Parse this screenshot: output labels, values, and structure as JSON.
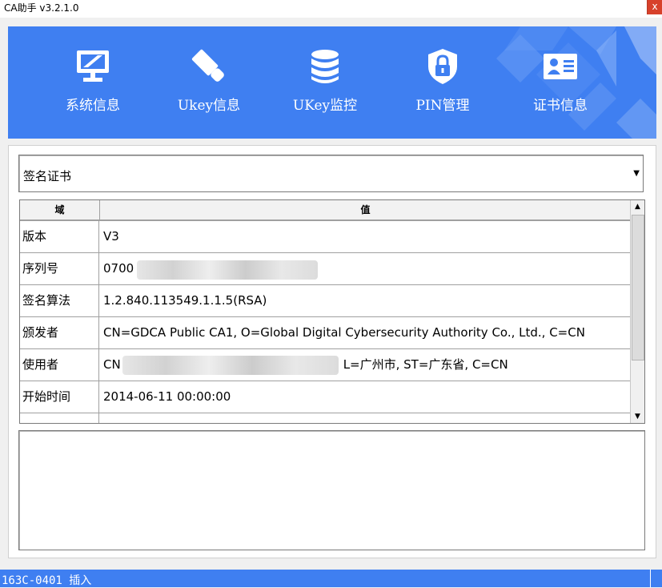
{
  "window": {
    "title": "CA助手 v3.2.1.0",
    "close_label": "x"
  },
  "colors": {
    "brand": "#3f7ff1",
    "close": "#d7412b"
  },
  "nav": [
    {
      "label": "系统信息",
      "icon": "monitor-icon"
    },
    {
      "label": "Ukey信息",
      "icon": "usb-key-icon"
    },
    {
      "label": "UKey监控",
      "icon": "database-icon"
    },
    {
      "label": "PIN管理",
      "icon": "lock-shield-icon"
    },
    {
      "label": "证书信息",
      "icon": "id-card-icon"
    }
  ],
  "cert_select": {
    "value": "签名证书"
  },
  "grid": {
    "columns": [
      "域",
      "值"
    ],
    "rows": [
      {
        "field": "版本",
        "value": "V3"
      },
      {
        "field": "序列号",
        "value": "0700"
      },
      {
        "field": "签名算法",
        "value": "1.2.840.113549.1.1.5(RSA)"
      },
      {
        "field": "颁发者",
        "value": "CN=GDCA Public CA1, O=Global Digital Cybersecurity Authority Co., Ltd., C=CN"
      },
      {
        "field": "使用者",
        "value_prefix": "CN",
        "value_suffix": "L=广州市, ST=广东省, C=CN"
      },
      {
        "field": "开始时间",
        "value": "2014-06-11 00:00:00"
      }
    ]
  },
  "status": {
    "text": "163C-0401 插入"
  }
}
